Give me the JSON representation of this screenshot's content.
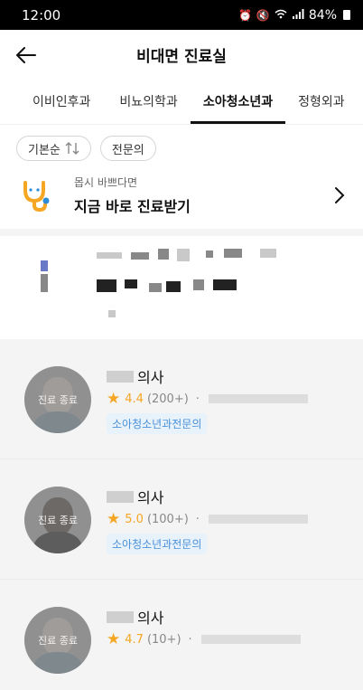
{
  "status_bar": {
    "time": "12:00",
    "battery": "84%"
  },
  "header": {
    "title": "비대면 진료실"
  },
  "tabs": [
    {
      "label": "이비인후과"
    },
    {
      "label": "비뇨의학과"
    },
    {
      "label": "소아청소년과"
    },
    {
      "label": "정형외과"
    }
  ],
  "filters": {
    "sort_label": "기본순",
    "specialist_label": "전문의"
  },
  "quick": {
    "sub": "몹시 바쁘다면",
    "main": "지금 바로 진료받기"
  },
  "doctors": [
    {
      "name_suffix": "의사",
      "rating": "4.4",
      "count": "(200+)",
      "dot": "·",
      "badge": "소아청소년과전문의",
      "status": "진료 종료"
    },
    {
      "name_suffix": "의사",
      "rating": "5.0",
      "count": "(100+)",
      "dot": "·",
      "badge": "소아청소년과전문의",
      "status": "진료 종료"
    },
    {
      "name_suffix": "의사",
      "rating": "4.7",
      "count": "(10+)",
      "dot": "·",
      "badge": "",
      "status": "진료 종료"
    }
  ],
  "colors": {
    "accent": "#f5a623",
    "badge_text": "#4a90d9",
    "list_bg": "#f4f4f5"
  }
}
